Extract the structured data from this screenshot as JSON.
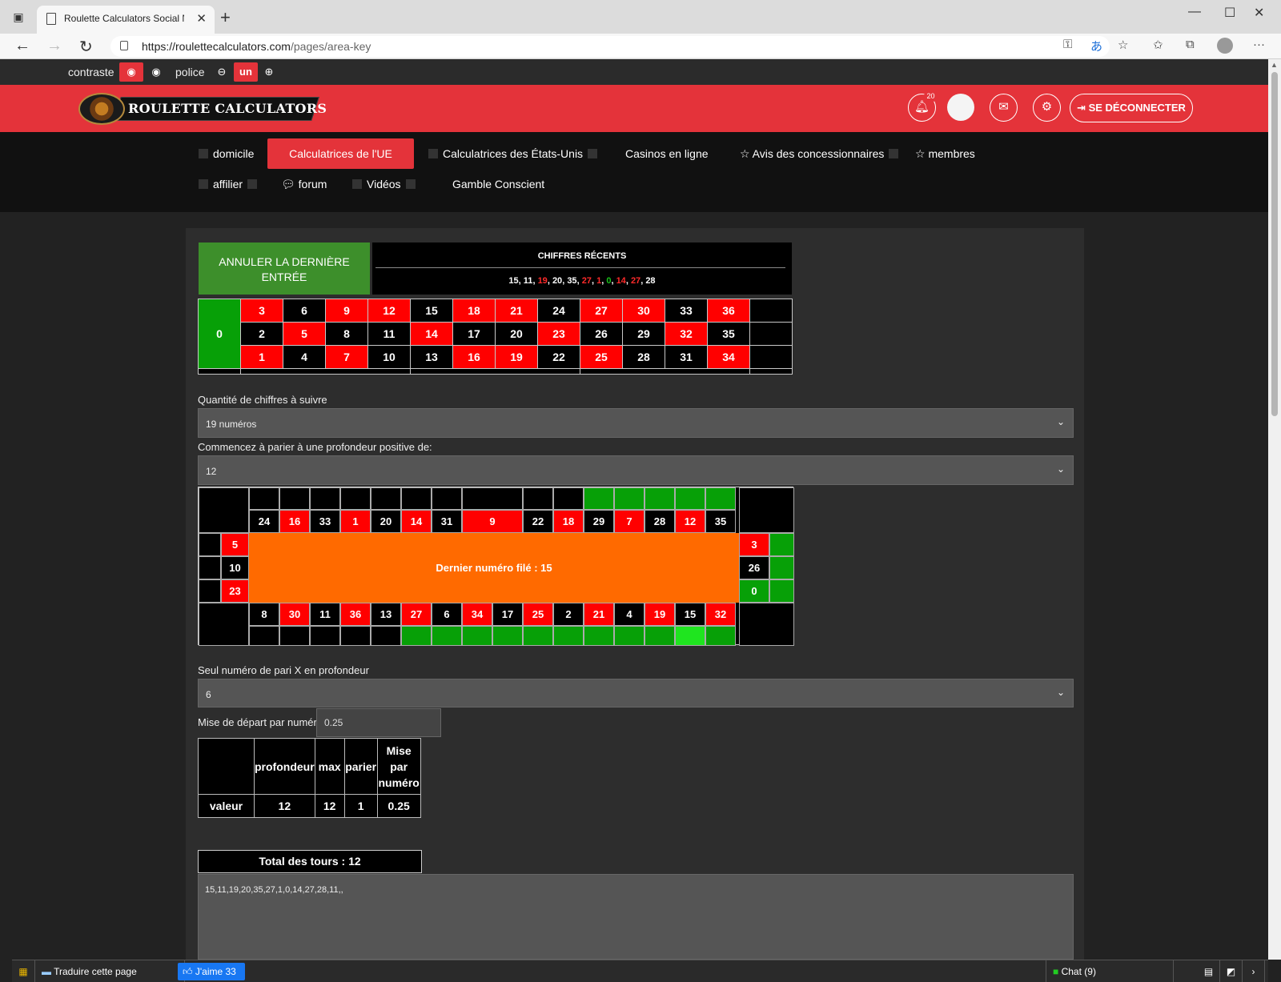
{
  "browser": {
    "tab_title": "Roulette Calculators Social Netw",
    "url_domain": "https://roulettecalculators.com",
    "url_path": "/pages/area-key"
  },
  "a11y": {
    "contrast_label": "contraste",
    "font_label": "police",
    "font_value": "un"
  },
  "header": {
    "logo_text": "ROULETTE CALCULATORS",
    "notification_count": "20",
    "logout_label": "SE DÉCONNECTER"
  },
  "nav": {
    "home": "domicile",
    "eu_calc": "Calculatrices de l'UE",
    "us_calc": "Calculatrices des États-Unis",
    "online_casinos": "Casinos en ligne",
    "dealer_reviews": "Avis des concessionnaires",
    "members": "membres",
    "affiliate": "affilier",
    "forum": "forum",
    "videos": "Vidéos",
    "gamble": "Gamble Conscient"
  },
  "undo_label_1": "ANNULER LA DERNIÈRE",
  "undo_label_2": "ENTRÉE",
  "recent": {
    "title": "CHIFFRES RÉCENTS",
    "numbers": [
      {
        "n": "15",
        "c": "#ffffff"
      },
      {
        "n": "11",
        "c": "#ffffff"
      },
      {
        "n": "19",
        "c": "#ff2a2a"
      },
      {
        "n": "20",
        "c": "#ffffff"
      },
      {
        "n": "35",
        "c": "#ffffff"
      },
      {
        "n": "27",
        "c": "#ff2a2a"
      },
      {
        "n": "1",
        "c": "#ff2a2a"
      },
      {
        "n": "0",
        "c": "#19c219"
      },
      {
        "n": "14",
        "c": "#ff2a2a"
      },
      {
        "n": "27",
        "c": "#ff2a2a"
      },
      {
        "n": "28",
        "c": "#ffffff"
      }
    ]
  },
  "grid": {
    "zero": "0",
    "rows": [
      [
        "3",
        "6",
        "9",
        "12",
        "15",
        "18",
        "21",
        "24",
        "27",
        "30",
        "33",
        "36"
      ],
      [
        "2",
        "5",
        "8",
        "11",
        "14",
        "17",
        "20",
        "23",
        "26",
        "29",
        "32",
        "35"
      ],
      [
        "1",
        "4",
        "7",
        "10",
        "13",
        "16",
        "19",
        "22",
        "25",
        "28",
        "31",
        "34"
      ]
    ],
    "red": [
      "1",
      "3",
      "5",
      "7",
      "9",
      "12",
      "14",
      "16",
      "18",
      "19",
      "21",
      "23",
      "25",
      "27",
      "30",
      "32",
      "34",
      "36"
    ]
  },
  "count_label": "Quantité de chiffres à suivre",
  "count_value": "19 numéros",
  "depth_label": "Commencez à parier à une profondeur positive de:",
  "depth_value": "12",
  "race": {
    "top": [
      "24",
      "16",
      "33",
      "1",
      "20",
      "14",
      "31",
      "9",
      "22",
      "18",
      "29",
      "7",
      "28",
      "12",
      "35"
    ],
    "right": [
      "3",
      "26",
      "0"
    ],
    "bottom": [
      "8",
      "30",
      "11",
      "36",
      "13",
      "27",
      "6",
      "34",
      "17",
      "25",
      "2",
      "21",
      "4",
      "19",
      "15",
      "32"
    ],
    "left": [
      "5",
      "10",
      "23"
    ],
    "center_text": "Dernier numéro filé : 15"
  },
  "single_label": "Seul numéro de pari X en profondeur",
  "single_value": "6",
  "stake_label": "Mise de départ par numéro",
  "stake_value": "0.25",
  "vtable": {
    "h_depth": "profondeur",
    "h_max": "max",
    "h_bet": "parier",
    "h_stake_1": "Mise",
    "h_stake_2": "par",
    "h_stake_3": "numéro",
    "row_label": "valeur",
    "depth": "12",
    "max": "12",
    "bet": "1",
    "stake": "0.25"
  },
  "total_label": "Total des tours : 12",
  "history": "15,11,19,20,35,27,1,0,14,27,28,11,,",
  "bottom": {
    "translate": "Traduire cette page",
    "like": "J'aime 33",
    "chat": "Chat (9)"
  },
  "colors": {
    "red": "#ff0000",
    "black": "#000000",
    "green": "#07a007",
    "bright_green": "#1fe51f"
  }
}
